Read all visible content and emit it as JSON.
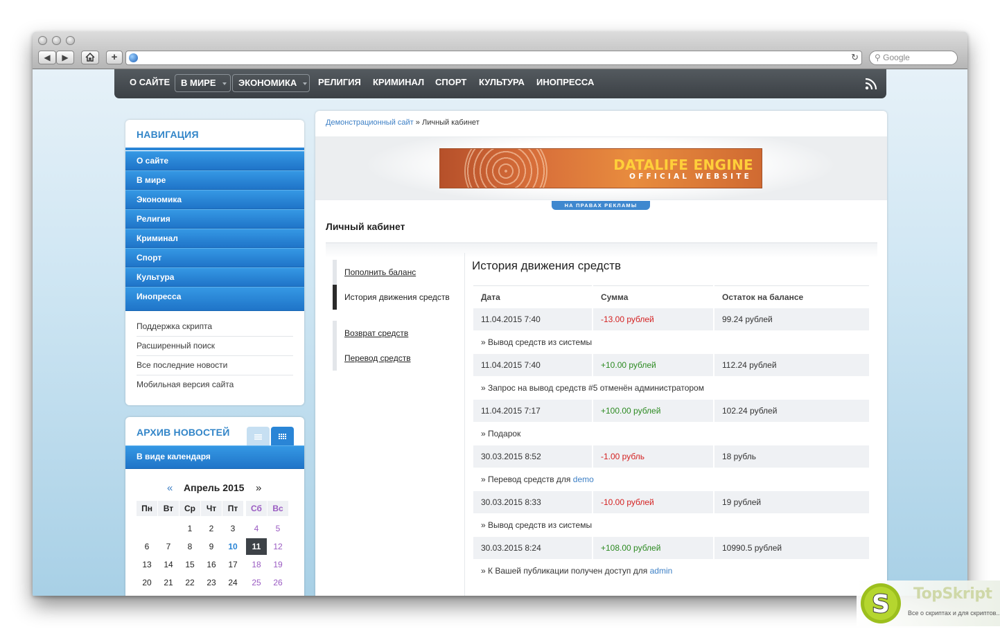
{
  "browser": {
    "search_placeholder": "Google"
  },
  "topmenu": {
    "items": [
      {
        "label": "О САЙТЕ"
      },
      {
        "label": "В МИРЕ"
      },
      {
        "label": "ЭКОНОМИКА"
      },
      {
        "label": "РЕЛИГИЯ"
      },
      {
        "label": "КРИМИНАЛ"
      },
      {
        "label": "СПОРТ"
      },
      {
        "label": "КУЛЬТУРА"
      },
      {
        "label": "ИНОПРЕССА"
      }
    ],
    "rss_icon": "rss-icon"
  },
  "navigation": {
    "title": "НАВИГАЦИЯ",
    "primary": [
      {
        "label": "О сайте"
      },
      {
        "label": "В мире"
      },
      {
        "label": "Экономика"
      },
      {
        "label": "Религия"
      },
      {
        "label": "Криминал"
      },
      {
        "label": "Спорт"
      },
      {
        "label": "Культура"
      },
      {
        "label": "Инопресса"
      }
    ],
    "secondary": [
      {
        "label": "Поддержка скрипта"
      },
      {
        "label": "Расширенный поиск"
      },
      {
        "label": "Все последние новости"
      },
      {
        "label": "Мобильная версия сайта"
      }
    ]
  },
  "archive": {
    "title": "АРХИВ НОВОСТЕЙ",
    "mode_label": "В виде календаря",
    "calendar": {
      "prev": "«",
      "next": "»",
      "month": "Апрель 2015",
      "weekdays": [
        "Пн",
        "Вт",
        "Ср",
        "Чт",
        "Пт",
        "Сб",
        "Вс"
      ],
      "days": [
        "1",
        "2",
        "3",
        "4",
        "5",
        "6",
        "7",
        "8",
        "9",
        "10",
        "11",
        "12",
        "13",
        "14",
        "15",
        "16",
        "17",
        "18",
        "19",
        "20",
        "21",
        "22",
        "23",
        "24",
        "25",
        "26"
      ],
      "today": "11",
      "linked_days": [
        "10"
      ]
    }
  },
  "main": {
    "breadcrumb": {
      "home": "Демонстрационный сайт",
      "separator": "»",
      "current": "Личный кабинет"
    },
    "banner": {
      "line1": "DATALIFE ENGINE",
      "line2": "OFFICIAL WEBSITE",
      "ad_label": "НА ПРАВАХ РЕКЛАМЫ"
    },
    "page_title": "Личный кабинет",
    "side_menu": [
      {
        "label": "Пополнить баланс"
      },
      {
        "label": "История движения средств"
      },
      {
        "label": "Возврат средств"
      },
      {
        "label": "Перевод средств"
      }
    ],
    "history": {
      "title": "История движения средств",
      "columns": [
        "Дата",
        "Сумма",
        "Остаток на балансе"
      ],
      "rows": [
        {
          "date": "11.04.2015 7:40",
          "amount": "-13.00 рублей",
          "sign": "neg",
          "balance": "99.24 рублей",
          "description": "» Вывод средств из системы",
          "link": ""
        },
        {
          "date": "11.04.2015 7:40",
          "amount": "+10.00 рублей",
          "sign": "pos",
          "balance": "112.24 рублей",
          "description": "» Запрос на вывод средств #5 отменён администратором",
          "link": ""
        },
        {
          "date": "11.04.2015 7:17",
          "amount": "+100.00 рублей",
          "sign": "pos",
          "balance": "102.24 рублей",
          "description": "» Подарок",
          "link": ""
        },
        {
          "date": "30.03.2015 8:52",
          "amount": "-1.00 рубль",
          "sign": "neg",
          "balance": "18 рубль",
          "description": "» Перевод средств для",
          "link": "demo"
        },
        {
          "date": "30.03.2015 8:33",
          "amount": "-10.00 рублей",
          "sign": "neg",
          "balance": "19 рублей",
          "description": "» Вывод средств из системы",
          "link": ""
        },
        {
          "date": "30.03.2015 8:24",
          "amount": "+108.00 рублей",
          "sign": "pos",
          "balance": "10990.5 рублей",
          "description": "» К Вашей публикации получен доступ для",
          "link": "admin"
        }
      ]
    }
  },
  "watermark": {
    "name": "TopSkript",
    "tagline": "Все о скриптах и для скриптов..."
  },
  "colors": {
    "accent_blue": "#2a85d6",
    "menu_dark": "#44494e",
    "negative": "#d42121",
    "positive": "#2c8a21",
    "weekend": "#9a5bc2"
  }
}
